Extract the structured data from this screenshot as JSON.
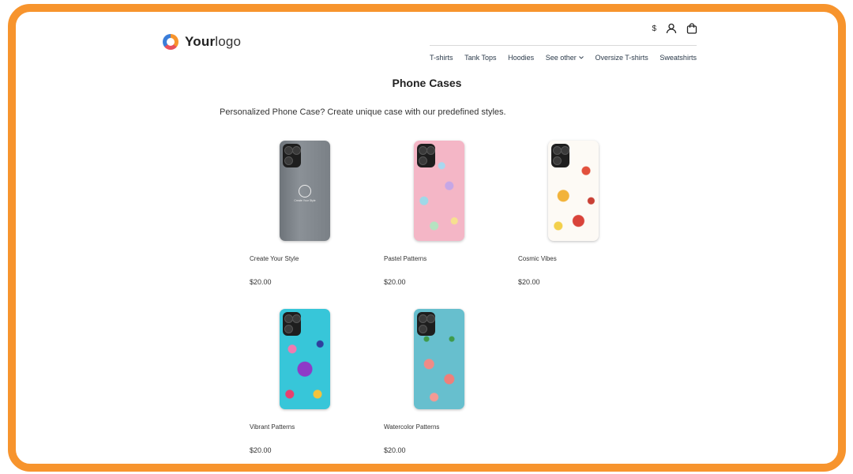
{
  "brand": {
    "logo_bold": "Your",
    "logo_light": "logo"
  },
  "utility": {
    "currency": "$",
    "account_icon": "user-icon",
    "cart_icon": "shopping-bag-icon"
  },
  "nav": {
    "items": [
      {
        "label": "T-shirts"
      },
      {
        "label": "Tank Tops"
      },
      {
        "label": "Hoodies"
      },
      {
        "label": "See other",
        "dropdown": true
      },
      {
        "label": "Oversize T-shirts"
      },
      {
        "label": "Sweatshirts"
      }
    ]
  },
  "page": {
    "title": "Phone Cases",
    "intro": "Personalized Phone Case? Create unique case with our predefined styles."
  },
  "products": [
    {
      "name": "Create Your Style",
      "price": "$20.00",
      "image_text": "Create Your Style"
    },
    {
      "name": "Pastel Patterns",
      "price": "$20.00"
    },
    {
      "name": "Cosmic Vibes",
      "price": "$20.00"
    },
    {
      "name": "Vibrant Patterns",
      "price": "$20.00"
    },
    {
      "name": "Watercolor Patterns",
      "price": "$20.00"
    }
  ],
  "colors": {
    "frame": "#F7942D",
    "text": "#333333"
  }
}
